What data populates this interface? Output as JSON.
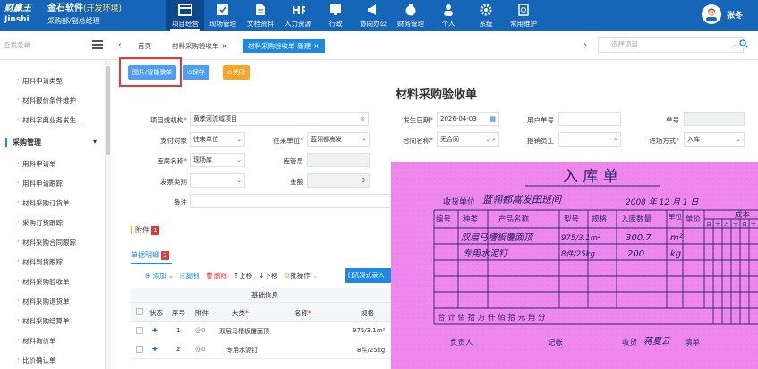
{
  "app": {
    "logo": "财赢王",
    "logo_sub": "Jinshi",
    "company": "金石软件",
    "env": "(开发环境)",
    "role": "采购部/副总经理",
    "user": "张冬"
  },
  "nav": [
    {
      "label": "项目经营",
      "icon": "project-icon",
      "active": true
    },
    {
      "label": "现场管理",
      "icon": "field-icon"
    },
    {
      "label": "文档资料",
      "icon": "document-icon"
    },
    {
      "label": "人力资源",
      "icon": "hr-icon"
    },
    {
      "label": "行政",
      "icon": "admin-icon"
    },
    {
      "label": "协同办公",
      "icon": "megaphone-icon"
    },
    {
      "label": "财务管理",
      "icon": "money-bag-icon"
    },
    {
      "label": "个人",
      "icon": "person-icon"
    },
    {
      "label": "系统",
      "icon": "gear-icon"
    },
    {
      "label": "常用维护",
      "icon": "bookmark-search-icon"
    }
  ],
  "tabbar": {
    "search_placeholder": "查找菜单",
    "home": "首页",
    "tabs": [
      {
        "label": "材料采购验收单"
      },
      {
        "label": "材料采购验收单-新建",
        "active": true
      }
    ],
    "select_placeholder": "选择项目"
  },
  "sidebar": {
    "items_top": [
      "用料申请类型",
      "材料报价条件维护",
      "材料字典业务发生..."
    ],
    "group": "采购管理",
    "items": [
      "用料申请单",
      "用料申请跟踪",
      "材料采购订货单",
      "采购订货跟踪",
      "材料采购合同跟踪",
      "材料到货跟踪",
      "材料采购验收单",
      "材料采购退货单",
      "材料采购结算单",
      "材料询价单",
      "比价确认单"
    ]
  },
  "toolbar": {
    "scan_label": "图片/智能录单",
    "save_label": "保存",
    "close_label": "关闭"
  },
  "form": {
    "title": "材料采购验收单",
    "project_label": "项目或机构",
    "project_value": "黄孝河流域项目",
    "date_label": "发生日期",
    "date_value": "2026-04-03",
    "user_no_label": "用户单号",
    "doc_no_label": "单号",
    "pay_target_label": "支付对象",
    "pay_target_value": "往来单位",
    "partner_label": "往来单位",
    "partner_value": "蓝翎都嵩发",
    "contract_label": "合同名称",
    "contract_value": "无合同",
    "handler_label": "报销员工",
    "entry_label": "进场方式",
    "entry_value": "入库",
    "warehouse_label": "库房名称",
    "warehouse_value": "现场库",
    "keeper_label": "库管员",
    "invoice_label": "发票类别",
    "amount_label": "金额",
    "amount_value": "0",
    "remark_label": "备注"
  },
  "attachment": {
    "label": "附件",
    "badge": "1"
  },
  "detail": {
    "tab": "单据明细",
    "badge": "2",
    "actions": [
      "添加",
      "复制",
      "删除",
      "上移",
      "下移",
      "批操作"
    ],
    "button": "[]沉浸式录入",
    "group_header": "基础信息",
    "columns": [
      "状态",
      "序号",
      "附件",
      "大类",
      "名称",
      "规格"
    ],
    "rows": [
      {
        "no": "1",
        "attach": "@0",
        "category": "双层马槽板覆面顶",
        "spec": "975/3.1m²"
      },
      {
        "no": "2",
        "attach": "@0",
        "category": "专用水泥钉",
        "spec": "8件/25kg"
      }
    ]
  },
  "receipt": {
    "title": "入 库 单",
    "unit_label": "收货单位",
    "unit_value": "蓝翎都嵩发田班间",
    "date_value": "2008 年 12 月 1 日",
    "headers": [
      "编号",
      "种类",
      "产品名称",
      "型号",
      "规格",
      "入库数量",
      "单位",
      "单价",
      "成本"
    ],
    "money_cols": [
      "百",
      "十",
      "万",
      "千",
      "百",
      "十"
    ],
    "rows": [
      {
        "name": "双层马槽板覆面顶",
        "spec": "975/3.1m²",
        "qty": "300.7",
        "unit": "m²"
      },
      {
        "name": "专用水泥钉",
        "spec": "8件/25kg",
        "qty": "200",
        "unit": "kg"
      }
    ],
    "total_row": "合 计    佰 拾 万 仟 佰 拾 元 角 分",
    "footer": {
      "owner_label": "负责人",
      "clerk_label": "记帐",
      "receiver_label": "收货",
      "receiver_value": "蒋夏云",
      "filler_label": "填单"
    }
  },
  "colors": {
    "brand": "#1565b8",
    "accent": "#1e88e5",
    "receipt_bg": "#ee88ee",
    "ink": "#2a2a6a"
  }
}
